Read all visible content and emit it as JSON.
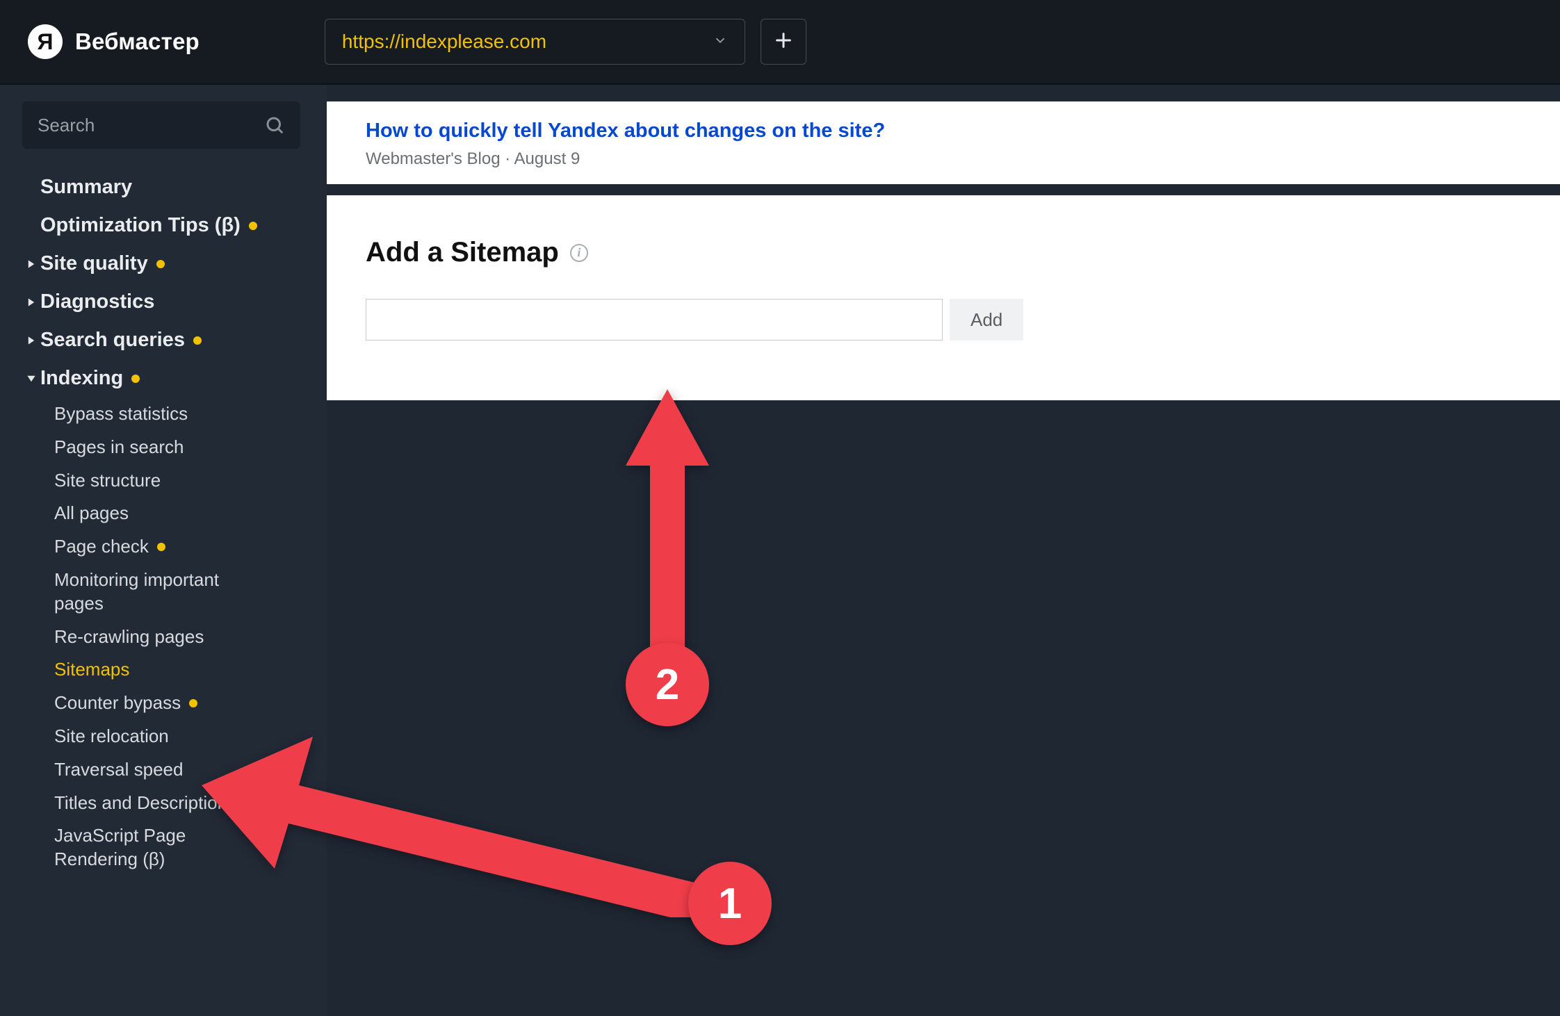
{
  "header": {
    "brand_letter": "Я",
    "brand_name": "Вебмастер",
    "site_url": "https://indexplease.com"
  },
  "sidebar": {
    "search_placeholder": "Search",
    "items": {
      "summary": "Summary",
      "optimization_tips": "Optimization Tips (β)",
      "site_quality": "Site quality",
      "diagnostics": "Diagnostics",
      "search_queries": "Search queries",
      "indexing": "Indexing"
    },
    "indexing_children": {
      "bypass_statistics": "Bypass statistics",
      "pages_in_search": "Pages in search",
      "site_structure": "Site structure",
      "all_pages": "All pages",
      "page_check": "Page check",
      "monitoring_important_pages": "Monitoring important pages",
      "recrawling_pages": "Re-crawling pages",
      "sitemaps": "Sitemaps",
      "counter_bypass": "Counter bypass",
      "site_relocation": "Site relocation",
      "traversal_speed": "Traversal speed",
      "titles_descriptions": "Titles and Descriptions",
      "javascript_rendering": "JavaScript Page Rendering (β)"
    }
  },
  "banner": {
    "title": "How to quickly tell Yandex about changes on the site?",
    "subtitle": "Webmaster's Blog · August 9"
  },
  "panel": {
    "title": "Add a Sitemap",
    "add_button": "Add"
  },
  "annotations": {
    "one": "1",
    "two": "2"
  },
  "colors": {
    "accent_yellow": "#f2c200",
    "link_blue": "#0649cc",
    "annotation_red": "#ef3d4a",
    "bg_dark": "#1f2733",
    "header_dark": "#161b22"
  }
}
